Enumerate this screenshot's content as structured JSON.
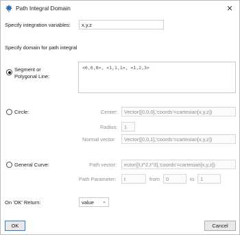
{
  "window": {
    "title": "Path Integral Domain",
    "close_glyph": "✕",
    "icon": "maple-leaf-icon",
    "accent": "#2e7bd6"
  },
  "integration": {
    "label": "Specify integration variables:",
    "value": "x,y,z"
  },
  "domain": {
    "heading": "Specify domain for path integral"
  },
  "segment": {
    "label_line1": "Segment or",
    "label_line2": "Polygonal Line:",
    "value": "<0,0,0>, <1,1,1>, <1,2,3>",
    "selected": true
  },
  "circle": {
    "label": "Circle:",
    "center_label": "Center:",
    "center_value": "Vector([0,0,0],'coords'=cartesian[x,y,z])",
    "radius_label": "Radius:",
    "radius_value": "1",
    "normal_label": "Normal vector:",
    "normal_value": "Vector([0,0,1],'coords'=cartesian[x,y,z])"
  },
  "curve": {
    "label": "General Curve:",
    "path_vector_label": "Path vector:",
    "path_vector_value": "ector([t,t^2,t^3],'coords'=cartesian[x,y,z])",
    "param_label": "Path Parameter:",
    "param_value": "t",
    "from_label": "from",
    "from_value": "0",
    "to_label": "to",
    "to_value": "1"
  },
  "on_ok": {
    "label": "On 'OK' Return:",
    "selected": "value",
    "caret": "⌄"
  },
  "buttons": {
    "ok": "OK",
    "cancel": "Cancel"
  }
}
